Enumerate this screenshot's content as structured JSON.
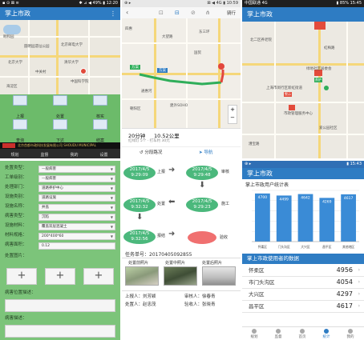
{
  "colors": {
    "brand": "#2e7cc3",
    "form_green": "#7cc47a",
    "node_green": "#4bb87c",
    "alert_red": "#f07070",
    "bar_blue": "#3a8bd6"
  },
  "panel1": {
    "status": {
      "left": "▪ ⊙ ⊠ ≡",
      "right": "✱ ⊿ ◀ 49% ▮ 12:20"
    },
    "title": "掌上市政",
    "menu_icon": "more-vert-icon",
    "map_labels": [
      "颐和园",
      "圆明园遗址公园",
      "北京大学",
      "清华大学",
      "北京邮电大学",
      "中国科学院",
      "海淀区",
      "中关村"
    ],
    "grid": [
      {
        "label": "上报",
        "icon": "report-icon"
      },
      {
        "label": "处置",
        "icon": "handle-icon"
      },
      {
        "label": "核实",
        "icon": "verify-icon"
      },
      {
        "label": "查询",
        "icon": "search-icon"
      },
      {
        "label": "下达",
        "icon": "dispatch-icon"
      },
      {
        "label": "结案",
        "icon": "close-case-icon"
      }
    ],
    "banner": "北京首都市政科技发展有限公司 SHOUDU MUNICIPAL",
    "nav": [
      {
        "label": "规划",
        "icon": "plan-icon"
      },
      {
        "label": "监督",
        "icon": "monitor-icon"
      },
      {
        "label": "我的",
        "icon": "user-icon"
      },
      {
        "label": "设置",
        "icon": "settings-icon"
      }
    ]
  },
  "panel2": {
    "status": {
      "left": "⊕ ▸",
      "right": "⊠ ◀ 4G ▮ 10:59"
    },
    "back_icon": "back-arrow-icon",
    "mode_icons": [
      "bus-icon",
      "car-icon",
      "bike-icon",
      "walk-icon"
    ],
    "route_right": "骑行",
    "start_tag": "方案",
    "end_tag": "方案",
    "map_labels": [
      "四惠",
      "大望路",
      "国贸",
      "建外SOHO",
      "朝阳区",
      "东三环",
      "通惠河"
    ],
    "zoom_in": "+",
    "zoom_out": "−",
    "route_time": "20分钟",
    "route_dist": "10.52公里",
    "route_detail": "红绿灯 5个 · 打车约 30元",
    "btn_route": "分段路况",
    "btn_nav": "导航"
  },
  "panel3": {
    "status": {
      "left": "中国联通 4G",
      "right": "▮ 85% 15:45"
    },
    "title": "掌上市政",
    "map_labels": [
      "绿地社区居委会",
      "上海市闵行区新虹街道",
      "北二区养老院",
      "爱公园社区",
      "漕宝路",
      "虹梅路"
    ],
    "pin_a": "警示",
    "pin_b": "养护",
    "cluster_label": "市政管理服务中心"
  },
  "panel4": {
    "rows": [
      {
        "k": "处置类型：",
        "v": "—般病害"
      },
      {
        "k": "工单级别：",
        "v": "—般病害"
      },
      {
        "k": "处理部门：",
        "v": "道路养护中心"
      },
      {
        "k": "设施类别：",
        "v": "道路设施"
      },
      {
        "k": "设施名称：",
        "v": "井盖"
      },
      {
        "k": "病害类型：",
        "v": "沉陷"
      },
      {
        "k": "设施材料：",
        "v": "覆盖双层混凝土"
      },
      {
        "k": "材料规格：",
        "v": "200*400*60"
      },
      {
        "k": "病害面积：",
        "v": "0.12"
      },
      {
        "k": "处置图片：",
        "v": ""
      }
    ],
    "add_label": "+",
    "footer_label_1": "病害位置描述：",
    "footer_label_2": "病害描述："
  },
  "panel5": {
    "nodes": [
      {
        "date": "2017/4/5",
        "time": "9:29:09",
        "step": "上报"
      },
      {
        "date": "2017/4/5",
        "time": "9:29:48",
        "step": "审核"
      },
      {
        "date": "2017/4/5",
        "time": "9:32:32",
        "step": "处置"
      },
      {
        "date": "2017/4/5",
        "time": "9:29:23",
        "step": "施工"
      },
      {
        "date": "2017/4/5",
        "time": "9:32:56",
        "step": "报结"
      }
    ],
    "end_step": "验收",
    "task_label": "任务单号：",
    "task_no": "20170405092855",
    "photo_labels": [
      "处置前照片",
      "处置中照片",
      "处置后照片"
    ],
    "reporter_label": "上报人：",
    "reporter": "刘芳颖",
    "auditor_label": "审核人：",
    "auditor": "徐春青",
    "handler_label": "处置人：",
    "handler": "赵忠茂",
    "verifier_label": "验收人：",
    "verifier": "张晓青"
  },
  "panel6": {
    "status": {
      "left": "⊕ ▸",
      "right": "▮ 15:43"
    },
    "title": "掌上市政",
    "chart_title": "掌上市政用户统计表",
    "section_title": "掌上市政使用者的数据",
    "districts": [
      {
        "name": "怀柔区",
        "value": "4956"
      },
      {
        "name": "市门头沟区",
        "value": "4054"
      },
      {
        "name": "大兴区",
        "value": "4297"
      },
      {
        "name": "昌平区",
        "value": "4617"
      }
    ],
    "tabs": [
      {
        "label": "规划",
        "icon": "plan-icon"
      },
      {
        "label": "监督",
        "icon": "monitor-icon"
      },
      {
        "label": "首页",
        "icon": "home-icon"
      },
      {
        "label": "统计",
        "icon": "stats-icon"
      },
      {
        "label": "我的",
        "icon": "user-icon"
      }
    ]
  },
  "chart_data": {
    "type": "bar",
    "title": "掌上市政用户统计表",
    "categories": [
      "怀柔区",
      "门头沟区",
      "大兴区",
      "昌平区",
      "其他地区"
    ],
    "values": [
      4700,
      4499,
      4642,
      4269,
      4617
    ],
    "ylim": [
      0,
      5000
    ],
    "grid": true,
    "bar_color": "#3a8bd6"
  }
}
